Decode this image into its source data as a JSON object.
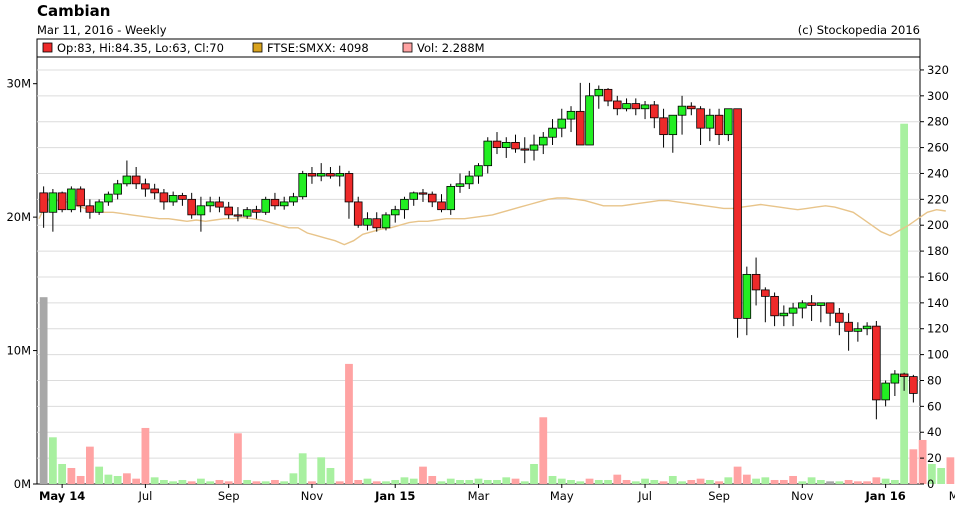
{
  "chart_data": {
    "type": "candlestick",
    "title": "Cambian",
    "subtitle": "Mar 11, 2016 - Weekly",
    "copyright": "(c) Stockopedia 2016",
    "legend": {
      "position": "top-left",
      "entries": [
        {
          "label": "Op:83, Hi:84.35, Lo:63, Cl:70",
          "color": "#ee2a2a"
        },
        {
          "label": "FTSE:SMXX: 4098",
          "color": "#d9a31e"
        },
        {
          "label": "Vol: 2.288M",
          "color": "#ffa3a3"
        }
      ]
    },
    "price_axis": {
      "range": [
        0,
        330
      ],
      "ticks": [
        "0",
        "20",
        "40",
        "60",
        "80",
        "100",
        "120",
        "140",
        "160",
        "180",
        "200",
        "220",
        "240",
        "260",
        "280",
        "300",
        "320"
      ]
    },
    "volume_axis": {
      "range": [
        0,
        32
      ],
      "ticks": [
        "0M",
        "10M",
        "20M",
        "30M"
      ]
    },
    "x_axis": {
      "labels": [
        {
          "text": "May 14",
          "bold": true,
          "week": 2
        },
        {
          "text": "Jul",
          "bold": false,
          "week": 11
        },
        {
          "text": "Sep",
          "bold": false,
          "week": 20
        },
        {
          "text": "Nov",
          "bold": false,
          "week": 29
        },
        {
          "text": "Jan 15",
          "bold": true,
          "week": 38
        },
        {
          "text": "Mar",
          "bold": false,
          "week": 47
        },
        {
          "text": "May",
          "bold": false,
          "week": 56
        },
        {
          "text": "Jul",
          "bold": false,
          "week": 65
        },
        {
          "text": "Sep",
          "bold": false,
          "week": 73
        },
        {
          "text": "Nov",
          "bold": false,
          "week": 82
        },
        {
          "text": "Jan 16",
          "bold": true,
          "week": 91
        },
        {
          "text": "Mar",
          "bold": false,
          "week": 99
        }
      ]
    },
    "candles": [
      [
        225,
        230,
        198,
        210
      ],
      [
        210,
        228,
        195,
        225
      ],
      [
        225,
        226,
        210,
        212
      ],
      [
        212,
        230,
        210,
        228
      ],
      [
        228,
        230,
        210,
        215
      ],
      [
        215,
        220,
        205,
        210
      ],
      [
        210,
        220,
        208,
        218
      ],
      [
        218,
        226,
        215,
        224
      ],
      [
        224,
        235,
        220,
        232
      ],
      [
        232,
        250,
        230,
        238
      ],
      [
        238,
        245,
        228,
        232
      ],
      [
        232,
        236,
        222,
        228
      ],
      [
        228,
        232,
        220,
        225
      ],
      [
        225,
        228,
        212,
        218
      ],
      [
        218,
        226,
        215,
        223
      ],
      [
        223,
        225,
        215,
        220
      ],
      [
        220,
        225,
        205,
        208
      ],
      [
        208,
        222,
        195,
        215
      ],
      [
        215,
        222,
        210,
        218
      ],
      [
        218,
        222,
        210,
        214
      ],
      [
        214,
        218,
        205,
        208
      ],
      [
        208,
        214,
        203,
        207
      ],
      [
        207,
        214,
        205,
        212
      ],
      [
        212,
        215,
        205,
        210
      ],
      [
        210,
        222,
        208,
        220
      ],
      [
        220,
        225,
        212,
        215
      ],
      [
        215,
        222,
        212,
        218
      ],
      [
        218,
        225,
        215,
        222
      ],
      [
        222,
        242,
        220,
        240
      ],
      [
        240,
        245,
        232,
        238
      ],
      [
        238,
        248,
        234,
        240
      ],
      [
        240,
        245,
        236,
        238
      ],
      [
        238,
        246,
        230,
        240
      ],
      [
        240,
        242,
        205,
        218
      ],
      [
        218,
        222,
        198,
        200
      ],
      [
        200,
        210,
        196,
        205
      ],
      [
        205,
        210,
        195,
        198
      ],
      [
        198,
        210,
        196,
        208
      ],
      [
        208,
        215,
        202,
        212
      ],
      [
        212,
        222,
        205,
        220
      ],
      [
        220,
        226,
        215,
        225
      ],
      [
        225,
        228,
        218,
        224
      ],
      [
        224,
        226,
        214,
        218
      ],
      [
        218,
        224,
        210,
        212
      ],
      [
        212,
        232,
        208,
        230
      ],
      [
        230,
        240,
        225,
        232
      ],
      [
        232,
        242,
        228,
        238
      ],
      [
        238,
        248,
        232,
        246
      ],
      [
        246,
        268,
        240,
        265
      ],
      [
        265,
        272,
        255,
        260
      ],
      [
        260,
        268,
        252,
        264
      ],
      [
        264,
        270,
        256,
        259
      ],
      [
        259,
        268,
        248,
        258
      ],
      [
        258,
        270,
        250,
        262
      ],
      [
        262,
        272,
        255,
        268
      ],
      [
        268,
        282,
        262,
        275
      ],
      [
        275,
        290,
        268,
        282
      ],
      [
        282,
        292,
        272,
        288
      ],
      [
        288,
        310,
        262,
        262
      ],
      [
        262,
        310,
        262,
        300
      ],
      [
        300,
        308,
        290,
        305
      ],
      [
        305,
        306,
        292,
        296
      ],
      [
        296,
        300,
        285,
        290
      ],
      [
        290,
        298,
        288,
        294
      ],
      [
        294,
        298,
        285,
        290
      ],
      [
        290,
        296,
        282,
        293
      ],
      [
        293,
        296,
        275,
        283
      ],
      [
        283,
        290,
        260,
        270
      ],
      [
        270,
        285,
        256,
        285
      ],
      [
        285,
        300,
        270,
        292
      ],
      [
        292,
        295,
        285,
        290
      ],
      [
        290,
        292,
        262,
        275
      ],
      [
        275,
        290,
        265,
        285
      ],
      [
        285,
        290,
        262,
        270
      ],
      [
        270,
        290,
        265,
        290
      ],
      [
        290,
        290,
        113,
        128
      ],
      [
        128,
        168,
        115,
        162
      ],
      [
        162,
        175,
        138,
        150
      ],
      [
        150,
        152,
        125,
        145
      ],
      [
        145,
        148,
        122,
        130
      ],
      [
        130,
        138,
        122,
        132
      ],
      [
        132,
        140,
        122,
        136
      ],
      [
        136,
        142,
        128,
        140
      ],
      [
        140,
        146,
        126,
        138
      ],
      [
        138,
        140,
        125,
        140
      ],
      [
        140,
        140,
        122,
        132
      ],
      [
        132,
        136,
        115,
        125
      ],
      [
        125,
        132,
        103,
        118
      ],
      [
        118,
        125,
        110,
        120
      ],
      [
        120,
        125,
        115,
        122
      ],
      [
        122,
        126,
        50,
        65
      ],
      [
        65,
        80,
        60,
        78
      ],
      [
        78,
        88,
        68,
        85
      ],
      [
        85,
        86,
        72,
        83
      ],
      [
        83,
        84.35,
        63,
        70
      ]
    ],
    "volume": [
      14,
      3.5,
      1.5,
      1.2,
      0.6,
      2.8,
      1.3,
      0.7,
      0.6,
      0.8,
      0.4,
      4.2,
      0.5,
      0.3,
      0.2,
      0.3,
      0.2,
      0.4,
      0.2,
      0.3,
      0.2,
      3.8,
      0.3,
      0.2,
      0.2,
      0.3,
      0.2,
      0.8,
      2.3,
      0.2,
      2.0,
      1.2,
      0.2,
      9.0,
      0.3,
      0.4,
      0.2,
      0.2,
      0.3,
      0.5,
      0.4,
      1.3,
      0.6,
      0.2,
      0.4,
      0.3,
      0.3,
      0.4,
      0.3,
      0.3,
      0.5,
      0.4,
      0.2,
      1.5,
      5.0,
      0.6,
      0.4,
      0.3,
      0.2,
      0.4,
      0.3,
      0.3,
      0.7,
      0.3,
      0.2,
      0.4,
      0.3,
      0.2,
      0.6,
      0.2,
      0.3,
      0.4,
      0.3,
      0.2,
      0.5,
      1.3,
      0.7,
      0.4,
      0.5,
      0.3,
      0.3,
      0.6,
      0.2,
      0.5,
      0.3,
      0.2,
      0.2,
      0.3,
      0.2,
      0.2,
      0.5,
      0.4,
      0.3,
      27,
      2.6,
      3.3,
      1.5,
      1.2,
      2.0
    ],
    "volume_color_flags": [
      "gray",
      "green",
      "green",
      "red",
      "red",
      "red",
      "green",
      "green",
      "green",
      "red",
      "red",
      "red",
      "green",
      "green",
      "green",
      "green",
      "red",
      "green",
      "green",
      "red",
      "red",
      "red",
      "green",
      "red",
      "green",
      "red",
      "green",
      "green",
      "green",
      "red",
      "green",
      "green",
      "red",
      "red",
      "red",
      "green",
      "red",
      "green",
      "green",
      "green",
      "green",
      "red",
      "red",
      "green",
      "green",
      "green",
      "green",
      "green",
      "green",
      "green",
      "green",
      "red",
      "green",
      "green",
      "red",
      "green",
      "green",
      "green",
      "green",
      "red",
      "green",
      "green",
      "red",
      "red",
      "green",
      "green",
      "green",
      "red",
      "green",
      "green",
      "red",
      "red",
      "green",
      "red",
      "green",
      "red",
      "red",
      "green",
      "green",
      "red",
      "red",
      "red",
      "green",
      "green",
      "green",
      "gray",
      "green",
      "red",
      "red",
      "red",
      "red",
      "green",
      "green",
      "green",
      "red",
      "red",
      "green",
      "green",
      "red"
    ],
    "index_line": [
      205,
      220,
      219,
      218,
      215,
      213,
      212,
      210,
      210,
      209,
      208,
      207,
      206,
      205,
      205,
      204,
      203,
      204,
      203,
      204,
      205,
      205,
      206,
      205,
      204,
      202,
      200,
      198,
      198,
      194,
      192,
      190,
      188,
      185,
      188,
      193,
      195,
      197,
      198,
      200,
      202,
      203,
      203,
      204,
      205,
      205,
      205,
      206,
      207,
      208,
      210,
      212,
      214,
      216,
      218,
      220,
      221,
      221,
      220,
      219,
      217,
      215,
      215,
      215,
      216,
      217,
      218,
      219,
      219,
      218,
      217,
      216,
      215,
      214,
      213,
      213,
      214,
      215,
      216,
      215,
      214,
      213,
      212,
      213,
      214,
      215,
      214,
      212,
      210,
      205,
      200,
      195,
      192,
      196,
      200,
      205,
      210,
      212,
      211
    ]
  }
}
